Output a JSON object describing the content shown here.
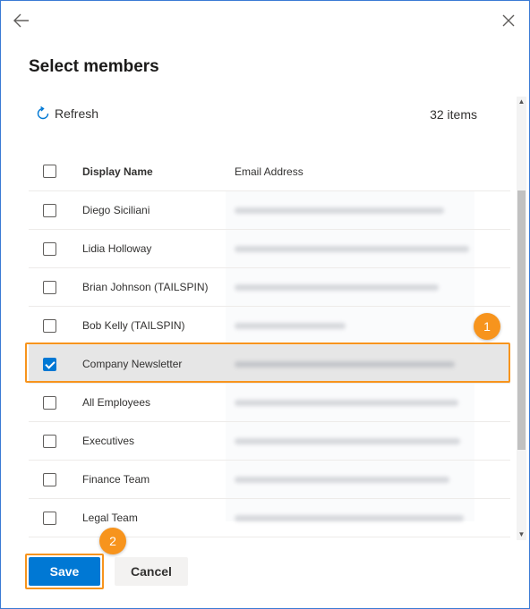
{
  "dialog": {
    "title": "Select members",
    "refresh_label": "Refresh",
    "items_count": "32 items"
  },
  "table": {
    "columns": {
      "display_name": "Display Name",
      "email_address": "Email Address"
    },
    "rows": [
      {
        "name": "Diego Siciliani",
        "checked": false
      },
      {
        "name": "Lidia Holloway",
        "checked": false
      },
      {
        "name": "Brian Johnson (TAILSPIN)",
        "checked": false
      },
      {
        "name": "Bob Kelly (TAILSPIN)",
        "checked": false
      },
      {
        "name": "Company Newsletter",
        "checked": true
      },
      {
        "name": "All Employees",
        "checked": false
      },
      {
        "name": "Executives",
        "checked": false
      },
      {
        "name": "Finance Team",
        "checked": false
      },
      {
        "name": "Legal Team",
        "checked": false
      }
    ]
  },
  "callouts": {
    "first": "1",
    "second": "2"
  },
  "actions": {
    "save_label": "Save",
    "cancel_label": "Cancel"
  },
  "colors": {
    "accent": "#0078d4",
    "callout": "#f7941d",
    "selected_row": "#e6e6e6"
  },
  "icons": {
    "back": "arrow-left-icon",
    "close": "close-icon",
    "refresh": "refresh-icon"
  }
}
